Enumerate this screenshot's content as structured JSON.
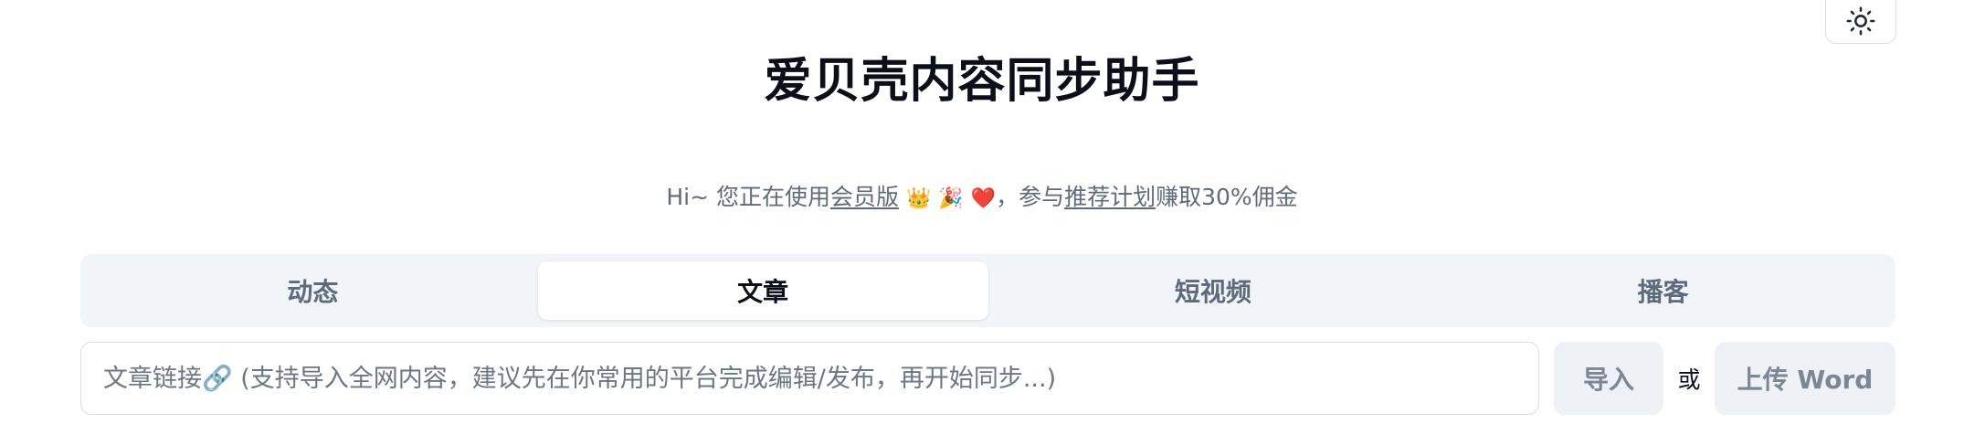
{
  "header": {
    "theme_toggle_icon": "sun-icon",
    "title": "爱贝壳内容同步助手"
  },
  "notice": {
    "prefix": "Hi~ 您正在使用",
    "member_link": "会员版",
    "emojis": [
      "👑",
      "🎉",
      "❤️"
    ],
    "middle": "，参与",
    "referral_link": "推荐计划",
    "suffix": "赚取30%佣金"
  },
  "tabs": [
    {
      "label": "动态",
      "active": false
    },
    {
      "label": "文章",
      "active": true
    },
    {
      "label": "短视频",
      "active": false
    },
    {
      "label": "播客",
      "active": false
    }
  ],
  "url_input": {
    "placeholder": "文章链接🔗 (支持导入全网内容，建议先在你常用的平台完成编辑/发布，再开始同步...)",
    "value": ""
  },
  "actions": {
    "import_label": "导入",
    "or_label": "或",
    "upload_label": "上传 Word"
  }
}
